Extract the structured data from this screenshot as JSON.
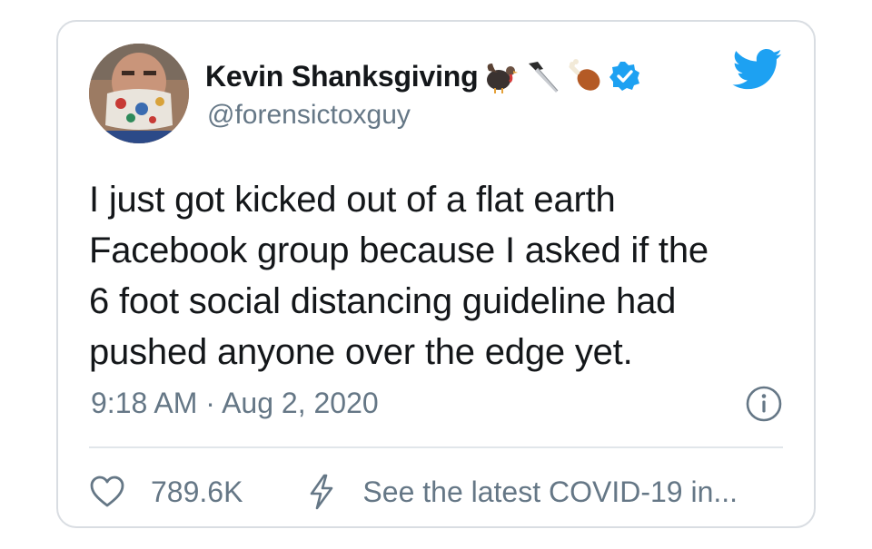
{
  "tweet": {
    "display_name": "Kevin Shanksgiving",
    "name_emojis": [
      "turkey-emoji",
      "knife-emoji",
      "drumstick-emoji"
    ],
    "handle": "@forensictoxguy",
    "text_lines": [
      "I just got kicked out of a flat earth",
      "Facebook group because I asked if the",
      "6 foot social distancing guideline had",
      "pushed anyone over the edge yet."
    ],
    "timestamp": "9:18 AM · Aug 2, 2020",
    "like_count": "789.6K",
    "covid_link_text": "See the latest COVID-19 in..."
  },
  "colors": {
    "text": "#14171a",
    "secondary": "#657786",
    "brand": "#1da1f2",
    "border": "#d9dde2"
  },
  "icons": {
    "verified": "verified-badge-icon",
    "brand": "twitter-bird-icon",
    "info": "info-icon",
    "like": "heart-icon",
    "covid": "lightning-bolt-icon"
  }
}
